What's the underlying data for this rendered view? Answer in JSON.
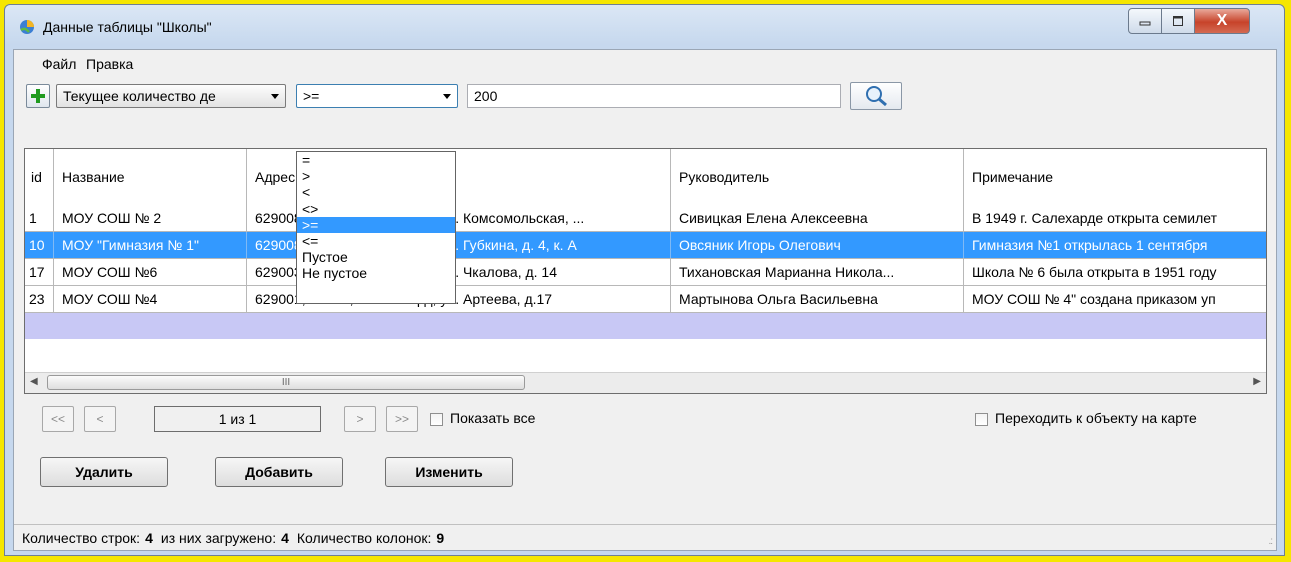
{
  "window": {
    "title": "Данные таблицы \"Школы\"",
    "close_glyph": "X"
  },
  "menu": [
    "Файл",
    "Правка"
  ],
  "toolbar": {
    "field_combo": "Текущее количество де",
    "operator_combo": ">=",
    "value": "200"
  },
  "operator_options": [
    "=",
    ">",
    "<",
    "<>",
    ">=",
    "<=",
    "Пустое",
    "Не пустое"
  ],
  "grid": {
    "columns": [
      "id",
      "Название",
      "Адрес",
      "Руководитель",
      "Примечание"
    ],
    "rows": [
      {
        "id": "1",
        "name": "МОУ СОШ № 2",
        "address": "629008, ЯНАО, г. Салехард, ул. Комсомольская, ...",
        "head": "Сивицкая Елена Алексеевна",
        "note": "В 1949 г. Салехарде открыта семилет"
      },
      {
        "id": "10",
        "name": "МОУ \"Гимназия № 1\"",
        "address": "629008, ЯНАО, г. Салехард, ул. Губкина, д. 4, к. А",
        "head": "Овсяник Игорь Олегович",
        "note": "Гимназия №1 открылась 1 сентября"
      },
      {
        "id": "17",
        "name": "МОУ СОШ №6",
        "address": "629003, ЯНАО, г. Салехард, ул. Чкалова, д. 14",
        "head": "Тихановская Марианна Никола...",
        "note": "Школа № 6 была открыта в 1951 году"
      },
      {
        "id": "23",
        "name": "МОУ СОШ №4",
        "address": "629001, ЯНАО, г. Салехард, ул. Артеева, д.17",
        "head": "Мартынова Ольга Васильевна",
        "note": "МОУ СОШ № 4\" создана приказом уп"
      }
    ],
    "selected_row": 1,
    "scrollbar_grip": "III"
  },
  "pager": {
    "first": "<<",
    "prev": "<",
    "page_text": "1 из 1",
    "next": ">",
    "last": ">>",
    "show_all_label": "Показать все",
    "goto_map_label": "Переходить к объекту на карте"
  },
  "actions": {
    "delete": "Удалить",
    "add": "Добавить",
    "edit": "Изменить"
  },
  "status": {
    "rows_label": "Количество строк:",
    "rows_value": "4",
    "loaded_label": "из них загружено:",
    "loaded_value": "4",
    "cols_label": "Количество колонок:",
    "cols_value": "9"
  },
  "colors": {
    "selection": "#3399ff",
    "new_row": "#c8c8f5",
    "outer_frame": "#f5e600"
  }
}
